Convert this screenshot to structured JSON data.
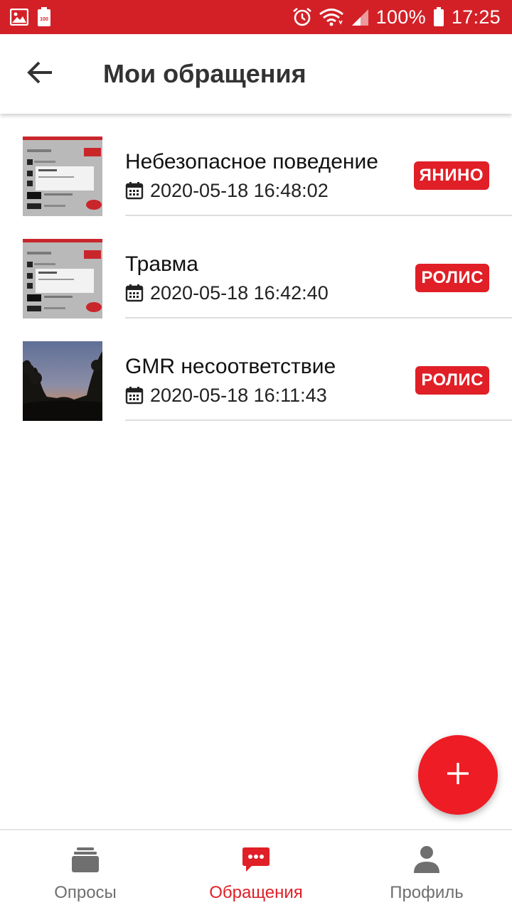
{
  "status_bar": {
    "battery_percent": "100%",
    "time": "17:25",
    "battery_small_label": "100",
    "icons": [
      "gallery-icon",
      "battery-saver-icon",
      "alarm-icon",
      "wifi-icon",
      "signal-icon",
      "battery-icon"
    ]
  },
  "header": {
    "back_icon": "arrow-left-icon",
    "title": "Мои обращения"
  },
  "items": [
    {
      "title": "Небезопасное поведение",
      "date": "2020-05-18 16:48:02",
      "badge": "ЯНИНО",
      "thumbnail": "screenshot-thumbnail"
    },
    {
      "title": "Травма",
      "date": "2020-05-18 16:42:40",
      "badge": "РОЛИС",
      "thumbnail": "screenshot-thumbnail"
    },
    {
      "title": "GMR несоответствие",
      "date": "2020-05-18 16:11:43",
      "badge": "РОЛИС",
      "thumbnail": "sunset-photo-thumbnail"
    }
  ],
  "fab": {
    "icon": "plus-icon"
  },
  "bottom_nav": {
    "tabs": [
      {
        "label": "Опросы",
        "icon": "stack-icon",
        "active": false
      },
      {
        "label": "Обращения",
        "icon": "chat-bubble-icon",
        "active": true
      },
      {
        "label": "Профиль",
        "icon": "person-icon",
        "active": false
      }
    ]
  },
  "colors": {
    "accent": "#e01f27",
    "status_bar": "#d32027",
    "fab": "#ee1c25",
    "inactive_tab": "#6f6f6f"
  }
}
